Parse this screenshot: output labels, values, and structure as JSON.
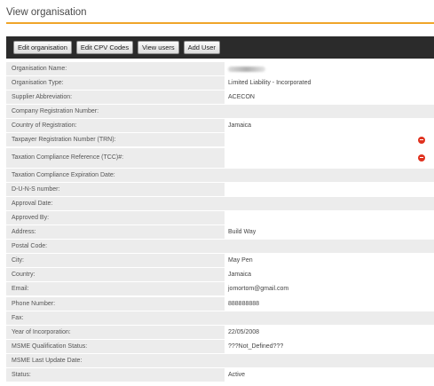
{
  "page": {
    "title": "View organisation",
    "accent_color": "#f0a52a",
    "toolbar_color": "#2b2b2b"
  },
  "toolbar": {
    "buttons": [
      {
        "label": "Edit organisation"
      },
      {
        "label": "Edit CPV Codes"
      },
      {
        "label": "View users"
      },
      {
        "label": "Add User"
      }
    ]
  },
  "details": {
    "rows": [
      {
        "label": "Organisation Name:",
        "value": ""
      },
      {
        "label": "Organisation Type:",
        "value": "Limited Liability - Incorporated"
      },
      {
        "label": "Supplier Abbreviation:",
        "value": "ACECON"
      },
      {
        "label": "Company Registration Number:",
        "value": ""
      },
      {
        "label": "Country of Registration:",
        "value": "Jamaica"
      },
      {
        "label": "Taxpayer Registration Number (TRN):",
        "value": "",
        "icon": "remove-circle-icon"
      },
      {
        "label": "Taxation Compliance Reference (TCC)#:",
        "value": "",
        "icon": "remove-circle-icon"
      },
      {
        "label": "Taxation Compliance Expiration Date:",
        "value": ""
      },
      {
        "label": "D-U-N-S number:",
        "value": ""
      },
      {
        "label": "Approval Date:",
        "value": ""
      },
      {
        "label": "Approved By:",
        "value": ""
      },
      {
        "label": "Address:",
        "value": "Build Way"
      },
      {
        "label": "Postal Code:",
        "value": ""
      },
      {
        "label": "City:",
        "value": "May Pen"
      },
      {
        "label": "Country:",
        "value": "Jamaica"
      },
      {
        "label": "Email:",
        "value": "jomortom@gmail.com"
      },
      {
        "label": "Phone Number:",
        "value": "888888888"
      },
      {
        "label": "Fax:",
        "value": ""
      },
      {
        "label": "Year of Incorporation:",
        "value": "22/05/2008"
      },
      {
        "label": "MSME Qualification Status:",
        "value": "???Not_Defined???"
      },
      {
        "label": "MSME Last Update Date:",
        "value": ""
      },
      {
        "label": "Status:",
        "value": "Active"
      }
    ]
  }
}
